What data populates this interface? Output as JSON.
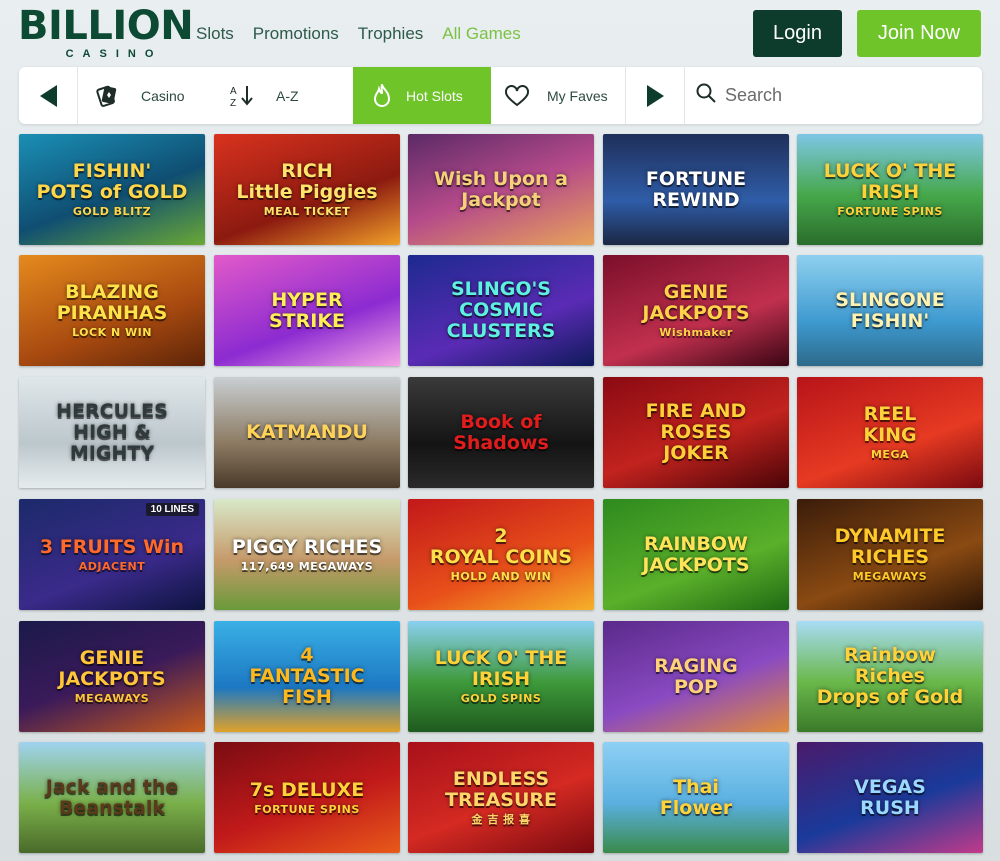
{
  "brand": {
    "name": "BILLION",
    "sub": "CASINO"
  },
  "nav": [
    "Slots",
    "Promotions",
    "Trophies",
    "All Games"
  ],
  "nav_active": "All Games",
  "auth": {
    "login": "Login",
    "join": "Join Now"
  },
  "filters": {
    "casino": "Casino",
    "az": "A-Z",
    "hot": "Hot Slots",
    "faves": "My Faves",
    "search_placeholder": "Search"
  },
  "colors": {
    "primary_dark": "#0d3b2c",
    "accent_green": "#6fc42a",
    "nav_text": "#2d5a49"
  },
  "games": [
    {
      "title": "FISHIN'\nPOTS of GOLD",
      "sub": "GOLD BLITZ",
      "bg": "linear-gradient(160deg,#1b8fb5,#0f4e72 55%,#6aa835)",
      "fg": "#ffd54a"
    },
    {
      "title": "RICH\nLittle Piggies",
      "sub": "MEAL TICKET",
      "bg": "linear-gradient(160deg,#d9321e,#8c1a10 60%,#f0a02a)",
      "fg": "#ffe46b"
    },
    {
      "title": "Wish Upon a\nJackpot",
      "sub": "",
      "bg": "linear-gradient(160deg,#5b2a66,#b54a8a 50%,#e7a35a)",
      "fg": "#f5d27a"
    },
    {
      "title": "FORTUNE\nREWIND",
      "sub": "",
      "bg": "linear-gradient(180deg,#1f2f5a,#2f5da8 60%,#1b2744)",
      "fg": "#ffffff"
    },
    {
      "title": "LUCK O' THE\nIRISH",
      "sub": "FORTUNE SPINS",
      "bg": "linear-gradient(180deg,#7ec7e6,#46a84a 55%,#2a6d2c)",
      "fg": "#ffd23a"
    },
    {
      "title": "BLAZING\nPIRANHAS",
      "sub": "LOCK N WIN",
      "bg": "linear-gradient(160deg,#e58a1d,#a84a10 60%,#5d2408)",
      "fg": "#ffe24a"
    },
    {
      "title": "HYPER\nSTRIKE",
      "sub": "",
      "bg": "linear-gradient(160deg,#e25ac9,#8c2bd1 60%,#f6a4e6)",
      "fg": "#ffee55"
    },
    {
      "title": "SLINGO'S\nCOSMIC CLUSTERS",
      "sub": "",
      "bg": "linear-gradient(160deg,#1d2a8f,#5a2bb5 60%,#0e1a5a)",
      "fg": "#5ef0e0"
    },
    {
      "title": "GENIE\nJACKPOTS",
      "sub": "Wishmaker",
      "bg": "linear-gradient(160deg,#7a0f2a,#c1304e 60%,#3a0614)",
      "fg": "#ffd24a"
    },
    {
      "title": "SLINGONE\nFISHIN'",
      "sub": "",
      "bg": "linear-gradient(180deg,#8fd0ef,#3e9ad0 60%,#2d6a8a)",
      "fg": "#fff2b0"
    },
    {
      "title": "HERCULES\nHIGH & MIGHTY",
      "sub": "",
      "bg": "linear-gradient(180deg,#dfe7ea,#bcc7cc 60%,#e6ecee)",
      "fg": "#2f3a3d"
    },
    {
      "title": "KATMANDU",
      "sub": "",
      "bg": "linear-gradient(180deg,#c9cfd3,#8c7a62 60%,#4a3a2a)",
      "fg": "#ffd35a"
    },
    {
      "title": "Book of\nShadows",
      "sub": "",
      "bg": "linear-gradient(180deg,#3a3a3a,#141414 60%,#2a2a2a)",
      "fg": "#e11c1c"
    },
    {
      "title": "FIRE AND ROSES\nJOKER",
      "sub": "",
      "bg": "linear-gradient(160deg,#8a0a12,#c2231e 55%,#4a0408)",
      "fg": "#ffcf3a"
    },
    {
      "title": "REEL\nKING",
      "sub": "MEGA",
      "bg": "linear-gradient(160deg,#b8141a,#e63a22 60%,#7a0a10)",
      "fg": "#ffd23a"
    },
    {
      "title": "3 FRUITS Win",
      "sub": "ADJACENT",
      "bg": "linear-gradient(160deg,#1c2a6a,#3a2a8a 60%,#0e1440)",
      "fg": "#ff6a2a",
      "badge": "10 LINES"
    },
    {
      "title": "PIGGY RICHES",
      "sub": "117,649 MEGAWAYS",
      "bg": "linear-gradient(180deg,#d8e9c9,#c69a6a 55%,#6a9a3a)",
      "fg": "#ffffff"
    },
    {
      "title": "2\nROYAL COINS",
      "sub": "HOLD AND WIN",
      "bg": "linear-gradient(160deg,#c2181a,#e8501a 60%,#f5b22a)",
      "fg": "#ffe04a"
    },
    {
      "title": "RAINBOW\nJACKPOTS",
      "sub": "",
      "bg": "linear-gradient(160deg,#2e8a1e,#5ab02a 60%,#1f6a14)",
      "fg": "#ffe45a"
    },
    {
      "title": "DYNAMITE\nRICHES",
      "sub": "MEGAWAYS",
      "bg": "linear-gradient(160deg,#3a1c0a,#8a4a12 60%,#2a1406)",
      "fg": "#ffc92a"
    },
    {
      "title": "GENIE\nJACKPOTS",
      "sub": "MEGAWAYS",
      "bg": "linear-gradient(160deg,#1a1a4a,#3a1a5a 50%,#c85a1a)",
      "fg": "#ffc63a"
    },
    {
      "title": "4\nFANTASTIC\nFISH",
      "sub": "",
      "bg": "linear-gradient(180deg,#3ab0e6,#1c78c2 60%,#e0a22a)",
      "fg": "#ffb81c"
    },
    {
      "title": "LUCK O' THE\nIRISH",
      "sub": "GOLD SPINS",
      "bg": "linear-gradient(180deg,#8ad0f0,#3e9a3a 55%,#1f5a1f)",
      "fg": "#ffd23a"
    },
    {
      "title": "RAGING\nPOP",
      "sub": "",
      "bg": "linear-gradient(160deg,#5a2a8a,#8a4ac2 55%,#e08a3a)",
      "fg": "#ffd27a"
    },
    {
      "title": "Rainbow Riches\nDrops of Gold",
      "sub": "",
      "bg": "linear-gradient(180deg,#a8dcf5,#6ab84a 55%,#3a7a2a)",
      "fg": "#ffd23a"
    },
    {
      "title": "Jack and the\nBeanstalk",
      "sub": "",
      "bg": "linear-gradient(180deg,#9fd3f0,#7ab04a 55%,#4a6a2a)",
      "fg": "#5a3a1a"
    },
    {
      "title": "7s DELUXE",
      "sub": "FORTUNE SPINS",
      "bg": "linear-gradient(160deg,#7a0c12,#c21a1a 55%,#e85a1a)",
      "fg": "#ffd23a"
    },
    {
      "title": "ENDLESS\nTREASURE",
      "sub": "金 吉 报 喜",
      "bg": "linear-gradient(160deg,#a8101a,#d42a22 55%,#7a0a10)",
      "fg": "#ffd66a"
    },
    {
      "title": "Thai\nFlower",
      "sub": "",
      "bg": "linear-gradient(180deg,#8fd0f5,#5ab0e0 55%,#3a8a4a)",
      "fg": "#ffd23a"
    },
    {
      "title": "VEGAS\nRUSH",
      "sub": "",
      "bg": "linear-gradient(160deg,#4a1a6a,#1a3a9a 55%,#c23a8a)",
      "fg": "#9ad8ff"
    }
  ]
}
